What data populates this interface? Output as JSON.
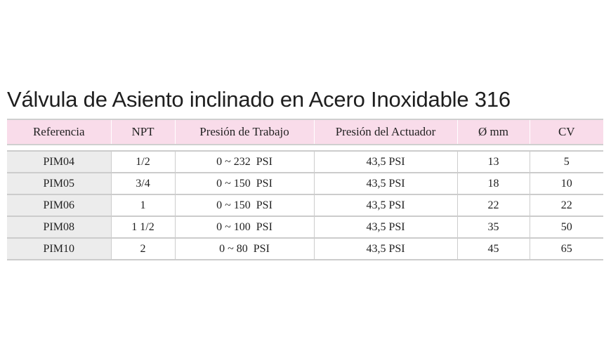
{
  "title": "Válvula de Asiento inclinado en Acero Inoxidable 316",
  "table": {
    "headers": [
      "Referencia",
      "NPT",
      "Presión de Trabajo",
      "Presión del Actuador",
      "Ø mm",
      "CV"
    ],
    "rows": [
      [
        "PIM04",
        "1/2",
        "0 ~ 232  PSI",
        "43,5 PSI",
        "13",
        "5"
      ],
      [
        "PIM05",
        "3/4",
        "0 ~ 150  PSI",
        "43,5 PSI",
        "18",
        "10"
      ],
      [
        "PIM06",
        "1",
        "0 ~ 150  PSI",
        "43,5 PSI",
        "22",
        "22"
      ],
      [
        "PIM08",
        "1 1/2",
        "0 ~ 100  PSI",
        "43,5 PSI",
        "35",
        "50"
      ],
      [
        "PIM10",
        "2",
        "0 ~ 80  PSI",
        "43,5 PSI",
        "45",
        "65"
      ]
    ]
  },
  "colors": {
    "header_bg": "#f9dcea",
    "reference_column_bg": "#ececec",
    "grid_lines": "#cccccc"
  }
}
